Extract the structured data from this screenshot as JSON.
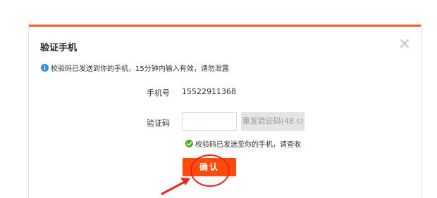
{
  "dialog": {
    "title": "验证手机",
    "close_icon": "close-icon",
    "notice": "校验码已发送到你的手机，15分钟内输入有效，请勿泄露",
    "phone": {
      "label": "手机号",
      "value": "15522911368"
    },
    "code": {
      "label": "验证码",
      "value": "",
      "placeholder": ""
    },
    "resend_label": "重发验证码(48 s)",
    "sent_status": "校验码已发送至你的手机，请查收",
    "confirm_label": "确认"
  },
  "colors": {
    "accent": "#ff5a1f",
    "button": "#ff4a0a",
    "info": "#2e8ddc",
    "success": "#4caf2a",
    "annotation": "#e8281c"
  }
}
